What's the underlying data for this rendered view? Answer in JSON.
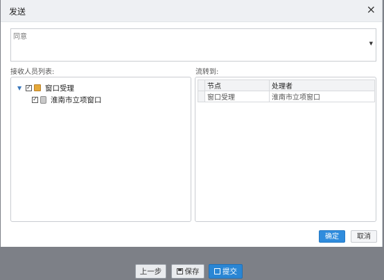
{
  "dialog": {
    "title": "发送",
    "close_glyph": "×"
  },
  "comment": {
    "value": "同意",
    "arrow": "▼"
  },
  "left_panel": {
    "label": "接收人员列表:",
    "tree": [
      {
        "label": "窗口受理",
        "checked": true,
        "expanded": true
      },
      {
        "label": "淮南市立项窗口",
        "checked": true
      }
    ]
  },
  "right_panel": {
    "label": "流转到:",
    "columns": [
      "节点",
      "处理者"
    ],
    "rows": [
      {
        "node": "窗口受理",
        "handler": "淮南市立项窗口"
      }
    ]
  },
  "buttons": {
    "ok": "确定",
    "cancel": "取消"
  },
  "bottom_bar": {
    "prev": "上一步",
    "save": "保存",
    "submit": "提交"
  },
  "colors": {
    "primary": "#2f8cdd",
    "overlay": "#7d8087",
    "titlebar": "#eef0f3"
  },
  "icons": {
    "check": "✓",
    "caret": "▼"
  }
}
